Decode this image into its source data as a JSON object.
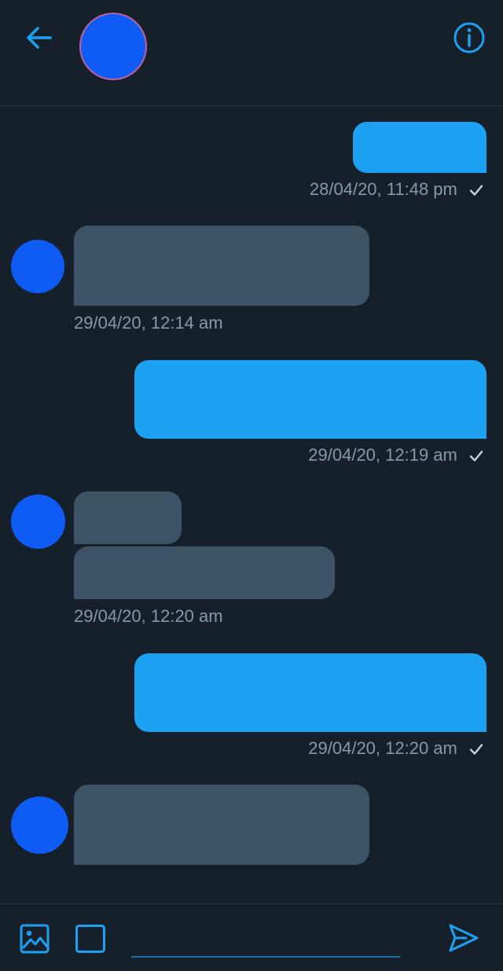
{
  "header": {
    "back_icon": "arrow-left-icon",
    "info_icon": "info-icon",
    "accent_color": "#1da1f2"
  },
  "messages": [
    {
      "direction": "outgoing",
      "timestamp": "28/04/20, 11:48 pm",
      "read_receipt": "check-icon"
    },
    {
      "direction": "incoming",
      "timestamp": "29/04/20, 12:14 am"
    },
    {
      "direction": "outgoing",
      "timestamp": "29/04/20, 12:19 am",
      "read_receipt": "check-icon"
    },
    {
      "direction": "incoming",
      "timestamp": "29/04/20, 12:20 am"
    },
    {
      "direction": "outgoing",
      "timestamp": "29/04/20, 12:20 am",
      "read_receipt": "check-icon"
    },
    {
      "direction": "incoming",
      "timestamp": ""
    }
  ],
  "composer": {
    "media_icon": "image-icon",
    "gif_icon": "square-icon",
    "input_value": "",
    "send_icon": "send-icon"
  },
  "colors": {
    "background": "#15202b",
    "outgoing_bubble": "#1da1f2",
    "incoming_bubble": "#3d5466",
    "avatar": "#0f5cf5",
    "timestamp": "#8899a6"
  }
}
